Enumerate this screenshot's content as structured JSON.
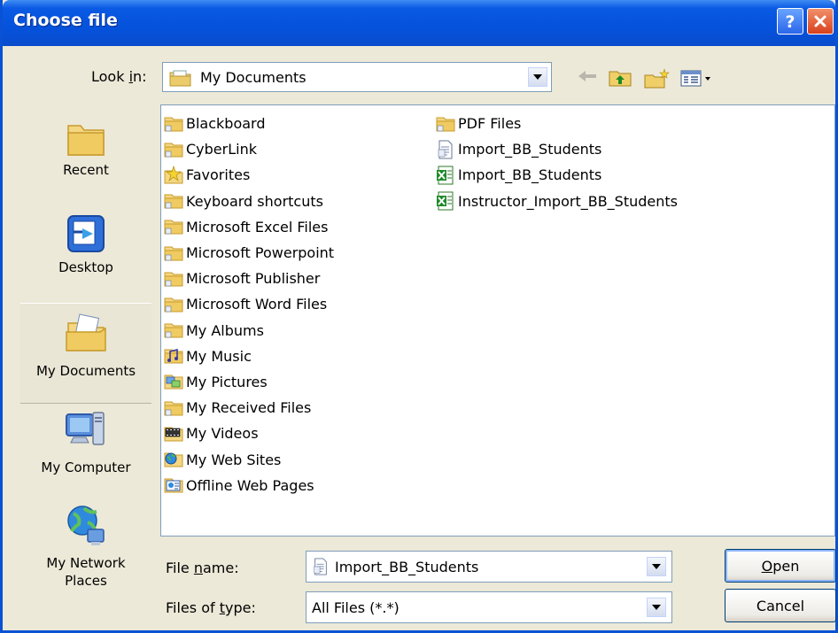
{
  "window": {
    "title": "Choose file"
  },
  "look_in": {
    "label_before": "Look ",
    "label_accel": "i",
    "label_after": "n:",
    "value": "My Documents"
  },
  "places": [
    {
      "label": "Recent",
      "icon": "recent-folder-icon"
    },
    {
      "label": "Desktop",
      "icon": "desktop-icon"
    },
    {
      "label": "My Documents",
      "icon": "my-documents-icon",
      "selected": true
    },
    {
      "label": "My Computer",
      "icon": "my-computer-icon"
    },
    {
      "label": "My Network Places",
      "icon": "network-places-icon"
    }
  ],
  "files_col1": [
    {
      "name": "Blackboard",
      "icon": "folder-icon"
    },
    {
      "name": "CyberLink",
      "icon": "folder-icon"
    },
    {
      "name": "Favorites",
      "icon": "favorites-folder-icon"
    },
    {
      "name": "Keyboard shortcuts",
      "icon": "folder-icon"
    },
    {
      "name": "Microsoft Excel Files",
      "icon": "folder-icon"
    },
    {
      "name": "Microsoft Powerpoint",
      "icon": "folder-icon"
    },
    {
      "name": "Microsoft Publisher",
      "icon": "folder-icon"
    },
    {
      "name": "Microsoft Word Files",
      "icon": "folder-icon"
    },
    {
      "name": "My Albums",
      "icon": "folder-icon"
    },
    {
      "name": "My Music",
      "icon": "music-folder-icon"
    },
    {
      "name": "My Pictures",
      "icon": "pictures-folder-icon"
    },
    {
      "name": "My Received Files",
      "icon": "folder-icon"
    },
    {
      "name": "My Videos",
      "icon": "videos-folder-icon"
    },
    {
      "name": "My Web Sites",
      "icon": "web-sites-folder-icon"
    },
    {
      "name": "Offline Web Pages",
      "icon": "offline-pages-folder-icon"
    }
  ],
  "files_col2": [
    {
      "name": "PDF Files",
      "icon": "folder-icon"
    },
    {
      "name": "Import_BB_Students",
      "icon": "text-file-icon"
    },
    {
      "name": "Import_BB_Students",
      "icon": "excel-file-icon"
    },
    {
      "name": "Instructor_Import_BB_Students",
      "icon": "excel-file-icon"
    }
  ],
  "file_name": {
    "label_before": "File ",
    "label_accel": "n",
    "label_after": "ame:",
    "value": "Import_BB_Students"
  },
  "files_of_type": {
    "label_before": "Files of ",
    "label_accel": "t",
    "label_after": "ype:",
    "value": "All Files (*.*)"
  },
  "buttons": {
    "open_accel": "O",
    "open_rest": "pen",
    "cancel": "Cancel"
  }
}
